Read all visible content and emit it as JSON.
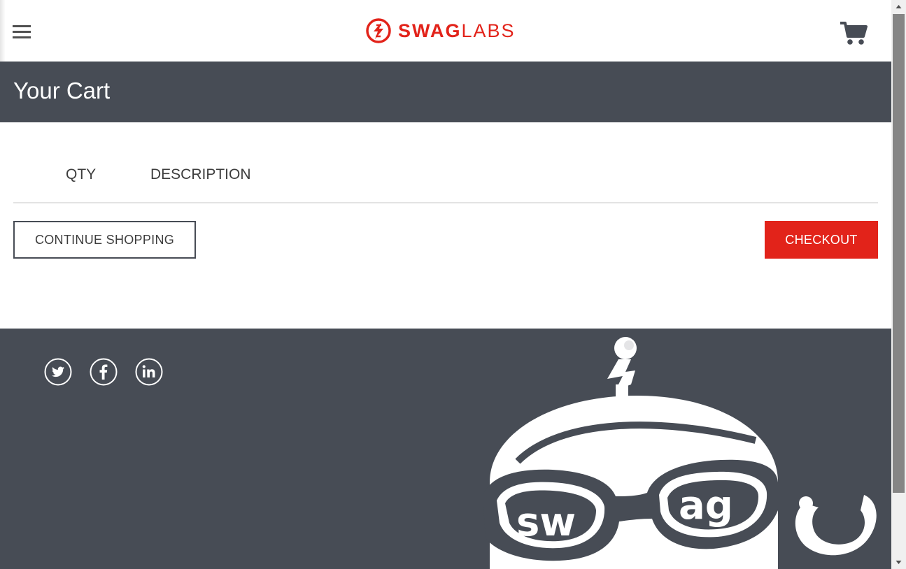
{
  "header": {
    "logo_text_bold": "SWAG",
    "logo_text_light": "LABS",
    "menu_icon": "hamburger-menu-icon",
    "cart_icon": "shopping-cart-icon"
  },
  "subheader": {
    "title": "Your Cart"
  },
  "cart_list": {
    "columns": {
      "qty": "QTY",
      "description": "DESCRIPTION"
    },
    "items": []
  },
  "actions": {
    "continue_shopping": "CONTINUE SHOPPING",
    "checkout": "CHECKOUT"
  },
  "footer": {
    "social_icons": [
      "twitter-icon",
      "facebook-icon",
      "linkedin-icon"
    ],
    "robot_text_left": "sw",
    "robot_text_right": "ag"
  },
  "colors": {
    "brand_red": "#e2231a",
    "dark_slate": "#474c55",
    "text": "#3d3d3d",
    "divider": "#e3e3e3"
  }
}
